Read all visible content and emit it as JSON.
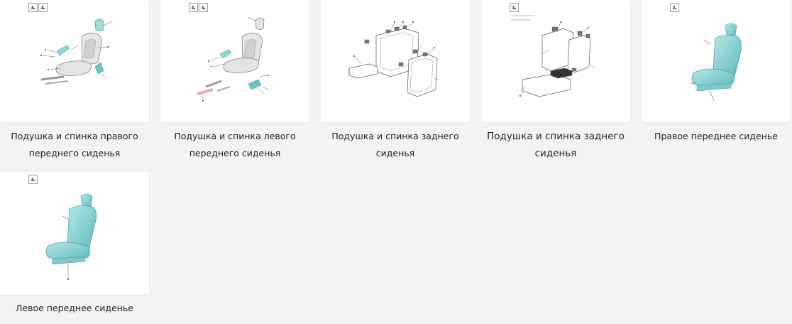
{
  "catalog": {
    "items": [
      {
        "id": "c1",
        "title": "Подушка и спинка правого переднего сиденья",
        "line1": "Подушка и спинка правого",
        "line2": "переднего сиденья",
        "icons": [
          "seat-view-icon",
          "seat-view-icon"
        ],
        "illustration": "front-seat-exploded-icon"
      },
      {
        "id": "c2",
        "title": "Подушка и спинка левого переднего сиденья",
        "line1": "Подушка и спинка левого",
        "line2": "переднего сиденья",
        "icons": [
          "seat-view-icon",
          "seat-view-icon"
        ],
        "illustration": "front-seat-exploded-icon"
      },
      {
        "id": "c3",
        "title": "Подушка и спинка заднего сиденья",
        "line1": "Подушка и спинка заднего",
        "line2": "сиденья",
        "icons": [],
        "illustration": "rear-seat-exploded-icon"
      },
      {
        "id": "c4",
        "title": "Подушка и спинка заднего сиденья",
        "line1": "Подушка и спинка заднего",
        "line2": "сиденья",
        "icons": [
          "seat-view-icon"
        ],
        "illustration": "rear-seat-exploded-icon"
      },
      {
        "id": "c5",
        "title": "Правое переднее сиденье",
        "line1": "Правое переднее сиденье",
        "line2": "",
        "icons": [
          "seat-view-icon"
        ],
        "illustration": "seat-assembly-icon"
      },
      {
        "id": "c6",
        "title": "Левое переднее сиденье",
        "line1": "Левое переднее сиденье",
        "line2": "",
        "icons": [
          "seat-view-icon"
        ],
        "illustration": "seat-assembly-icon"
      }
    ]
  },
  "colors": {
    "page_bg": "#f2f3f5",
    "card_bg": "#ffffff",
    "seat_teal": "#8fd6d8",
    "seat_teal_dark": "#5bb7ba",
    "highlight_pink": "#e9a3c3",
    "line_art": "#555555"
  }
}
